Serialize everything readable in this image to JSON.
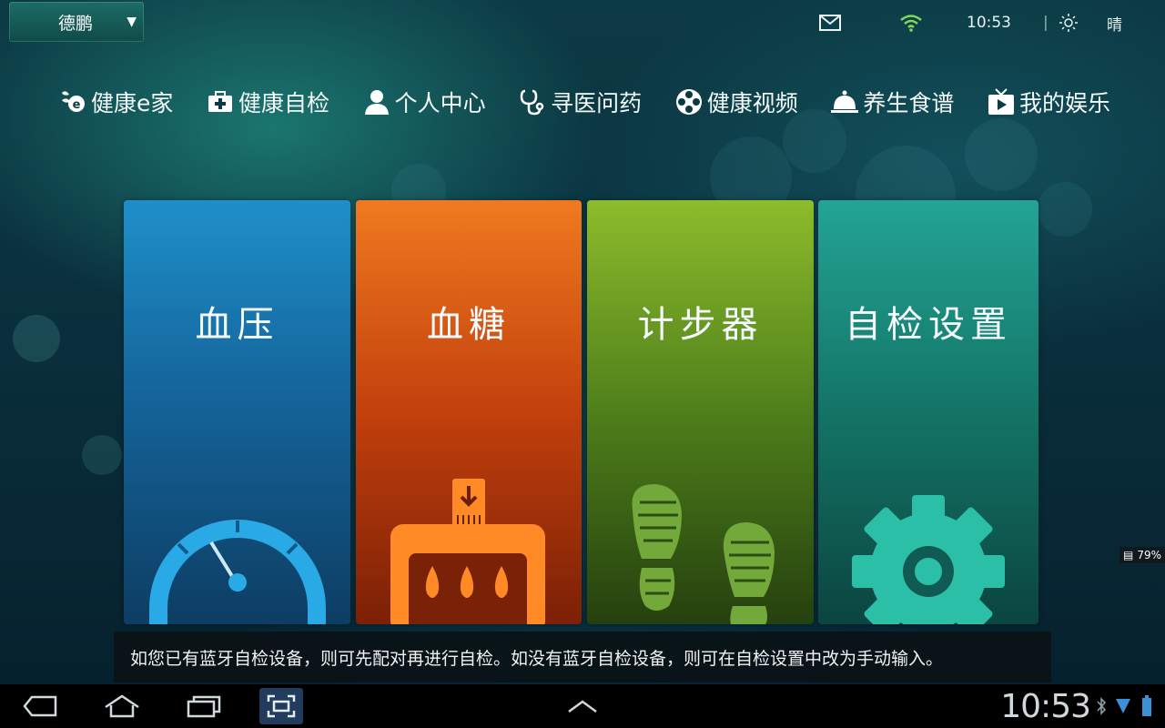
{
  "header": {
    "user_name": "德鹏",
    "time": "10:53",
    "weather": "晴",
    "icons": [
      "mail-icon",
      "wifi-icon",
      "sun-icon"
    ]
  },
  "nav": {
    "items": [
      {
        "label": "健康e家",
        "icon": "health-home-icon"
      },
      {
        "label": "健康自检",
        "icon": "medkit-icon"
      },
      {
        "label": "个人中心",
        "icon": "person-icon"
      },
      {
        "label": "寻医问药",
        "icon": "stethoscope-icon"
      },
      {
        "label": "健康视频",
        "icon": "film-reel-icon"
      },
      {
        "label": "养生食谱",
        "icon": "food-cloche-icon"
      },
      {
        "label": "我的娱乐",
        "icon": "tv-play-icon"
      }
    ]
  },
  "cards": [
    {
      "title": "血压",
      "icon": "gauge-icon",
      "color": "#1f8fc9"
    },
    {
      "title": "血糖",
      "icon": "glucose-meter-icon",
      "color": "#f07a20"
    },
    {
      "title": "计步器",
      "icon": "footprints-icon",
      "color": "#8dbc2c"
    },
    {
      "title": "自检设置",
      "icon": "gear-icon",
      "color": "#23a495"
    }
  ],
  "hint": "如您已有蓝牙自检设备，则可先配对再进行自检。如没有蓝牙自检设备，则可在自检设置中改为手动输入。",
  "battery_badge": "79%",
  "system_bar": {
    "clock": "10:53",
    "buttons": [
      "back-icon",
      "home-icon",
      "recent-apps-icon",
      "screenshot-icon",
      "chevron-up-icon"
    ]
  }
}
